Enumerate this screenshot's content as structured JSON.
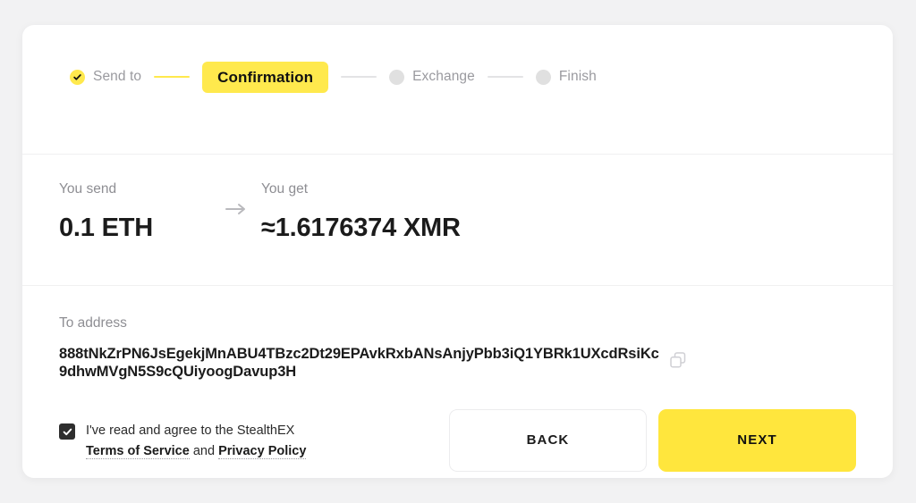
{
  "theme": {
    "accent_yellow": "#ffe94d",
    "next_button_yellow": "#ffe63d",
    "page_background": "#f2f2f3",
    "card_background": "#ffffff",
    "muted_text": "#8e8e93",
    "dark_text": "#1b1b1b"
  },
  "stepper": {
    "steps": [
      {
        "label": "Send to",
        "state": "done",
        "icon": "check-circle-icon"
      },
      {
        "label": "Confirmation",
        "state": "current",
        "icon": ""
      },
      {
        "label": "Exchange",
        "state": "pending",
        "icon": "dot-icon"
      },
      {
        "label": "Finish",
        "state": "pending",
        "icon": "dot-icon"
      }
    ]
  },
  "amounts": {
    "send_label": "You send",
    "send_value": "0.1 ETH",
    "arrow_icon": "arrow-right-icon",
    "get_label": "You get",
    "get_value": "≈1.6176374 XMR"
  },
  "address": {
    "label": "To address",
    "value": "888tNkZrPN6JsEgekjMnABU4TBzc2Dt29EPAvkRxbANsAnjyPbb3iQ1YBRk1UXcdRsiKc9dhwMVgN5S9cQUiyoogDavup3H",
    "copy_icon": "copy-icon"
  },
  "footer": {
    "checkbox_checked": true,
    "agreement_prefix": "I've read and agree to the StealthEX",
    "terms_link": "Terms of Service",
    "agreement_conjunction": "and",
    "privacy_link": "Privacy Policy",
    "back_label": "BACK",
    "next_label": "NEXT"
  }
}
